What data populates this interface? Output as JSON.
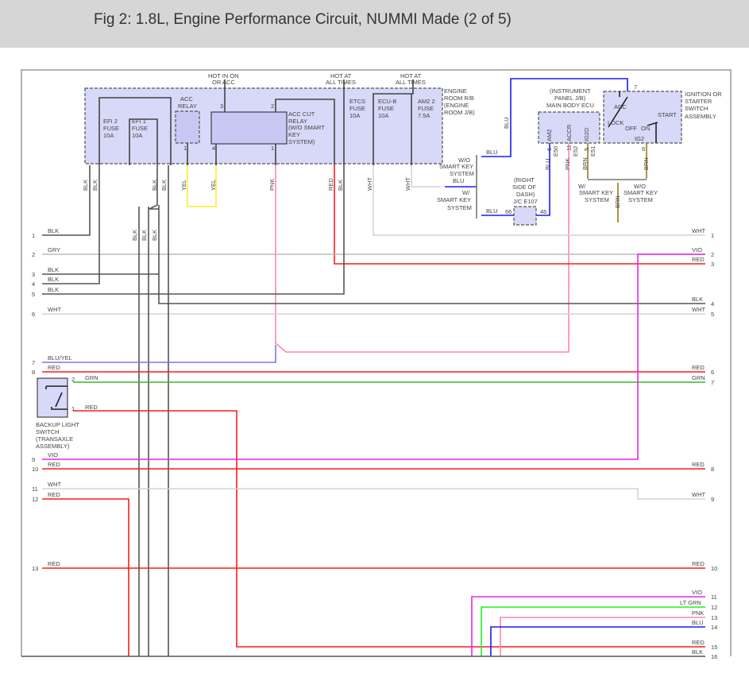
{
  "title": "Fig 2: 1.8L, Engine Performance Circuit, NUMMI Made (2 of 5)",
  "colors": {
    "BLK": "#555555",
    "GRY": "#bbbbbb",
    "WHT": "#d4d4d4",
    "RED": "#ff1a1a",
    "GRN": "#33bb22",
    "VIO": "#ee22ee",
    "BLU": "#1a1aff",
    "YEL": "#ffee22",
    "PNK": "#ff88aa",
    "BRN": "#9a7a1a",
    "LTGRN": "#22ee22",
    "BLUYEL": "#7777ee",
    "box": "#d8d8f8"
  },
  "top": {
    "hot_on_acc": [
      "HOT IN ON",
      "OR ACC"
    ],
    "hot1": [
      "HOT AT",
      "ALL TIMES"
    ],
    "hot2": [
      "HOT AT",
      "ALL TIMES"
    ],
    "engine_room": [
      "ENGINE",
      "ROOM R/B",
      "(ENGINE",
      "ROOM J/B)"
    ],
    "efi2": [
      "EFI 2",
      "FUSE",
      "10A"
    ],
    "efi1": [
      "EFI 1",
      "FUSE",
      "10A"
    ],
    "acc_relay": [
      "ACC",
      "RELAY"
    ],
    "acc_cut": [
      "ACC CUT",
      "RELAY",
      "(W/O SMART",
      "KEY",
      "SYSTEM)"
    ],
    "etcs": [
      "ETCS",
      "FUSE",
      "10A"
    ],
    "ecub": [
      "ECU-B",
      "FUSE",
      "10A"
    ],
    "am2": [
      "AM2 2",
      "FUSE",
      "7.5A"
    ],
    "pins": [
      "3",
      "2",
      "1",
      "4",
      "1"
    ],
    "wire_labels": [
      "BLK",
      "BLK",
      "BLK",
      "BLK",
      "YEL",
      "YEL",
      "PNK",
      "RED",
      "BLK",
      "WHT",
      "WHT"
    ]
  },
  "ecu": {
    "title": [
      "(INSTRUMENT",
      "PANEL J/B)",
      "MAIN BODY ECU"
    ],
    "terms": [
      "AM2",
      "ACCR",
      "IG2D"
    ],
    "pins": [
      "6",
      "11",
      "5"
    ],
    "conns": [
      "E50",
      "E52",
      "E51"
    ],
    "wires": [
      "BLU",
      "PNK",
      "BRN"
    ]
  },
  "ign": {
    "title": [
      "IGNITION OR",
      "STARTER",
      "SWITCH",
      "ASSEMBLY"
    ],
    "acc": "ACC",
    "lock": "LOCK",
    "off": "OFF",
    "on": "ON",
    "start": "START",
    "ig2": "IG2",
    "pin_top": "7",
    "pin_bot": "6",
    "wire": "BRN"
  },
  "jc": {
    "title": [
      "(RIGHT",
      "SIDE OF",
      "DASH)",
      "J/C E107"
    ],
    "pin_l": "66",
    "pin_r": "46"
  },
  "smart": {
    "wo": [
      "W/O",
      "SMART KEY",
      "SYSTEM"
    ],
    "w": [
      "W/",
      "SMART KEY",
      "SYSTEM"
    ],
    "blu1": "BLU",
    "blu2": "BLU",
    "blu3": "BLU",
    "blu_v": "BLU",
    "w2": [
      "W/",
      "SMART KEY",
      "SYSTEM"
    ],
    "wo2": [
      "W/O",
      "SMART KEY",
      "SYSTEM"
    ],
    "brn": "BRN"
  },
  "backup": {
    "title": [
      "BACKUP LIGHT",
      "SWITCH",
      "(TRANSAXLE",
      "ASSEMBLY)"
    ],
    "pin2": "2",
    "pin1": "1",
    "grn": "GRN",
    "red": "RED"
  },
  "left_pins": [
    {
      "n": "1",
      "c": "BLK"
    },
    {
      "n": "2",
      "c": "GRY"
    },
    {
      "n": "3",
      "c": "BLK"
    },
    {
      "n": "4",
      "c": "BLK"
    },
    {
      "n": "5",
      "c": "BLK"
    },
    {
      "n": "6",
      "c": "WHT"
    },
    {
      "n": "7",
      "c": "BLU/YEL"
    },
    {
      "n": "8",
      "c": "RED"
    },
    {
      "n": "9",
      "c": "VIO"
    },
    {
      "n": "10",
      "c": "RED"
    },
    {
      "n": "11",
      "c": "WHT"
    },
    {
      "n": "12",
      "c": "RED"
    },
    {
      "n": "13",
      "c": "RED"
    }
  ],
  "right_pins": [
    {
      "n": "1",
      "c": "WHT"
    },
    {
      "n": "2",
      "c": "VIO"
    },
    {
      "n": "3",
      "c": "RED"
    },
    {
      "n": "4",
      "c": "BLK"
    },
    {
      "n": "5",
      "c": "WHT"
    },
    {
      "n": "6",
      "c": "RED"
    },
    {
      "n": "7",
      "c": "GRN"
    },
    {
      "n": "8",
      "c": "RED"
    },
    {
      "n": "9",
      "c": "WHT"
    },
    {
      "n": "10",
      "c": "RED"
    },
    {
      "n": "11",
      "c": "VIO"
    },
    {
      "n": "12",
      "c": "LT GRN"
    },
    {
      "n": "13",
      "c": "PNK"
    },
    {
      "n": "14",
      "c": "BLU"
    },
    {
      "n": "15",
      "c": "RED"
    },
    {
      "n": "16",
      "c": "BLK"
    }
  ],
  "vert_blk": [
    "BLK",
    "BLK",
    "BLK"
  ]
}
